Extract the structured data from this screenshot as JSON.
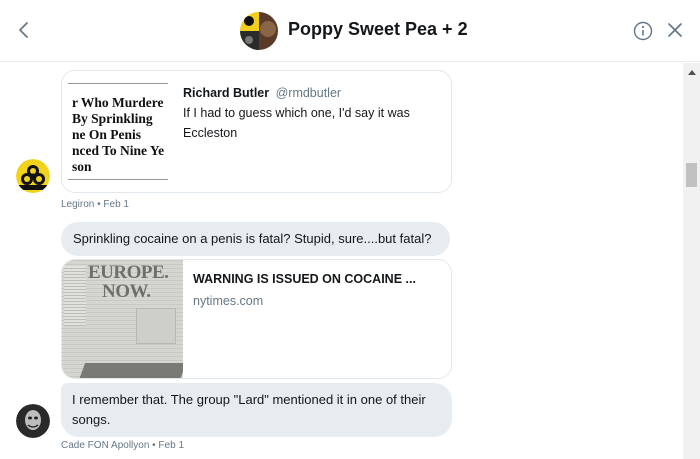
{
  "header": {
    "title": "Poppy Sweet Pea + 2"
  },
  "quoted_tweet": {
    "headline_lines": [
      "r Who Murdere",
      "By Sprinkling",
      "ne On Penis",
      "nced To Nine Ye",
      "son"
    ],
    "author_name": "Richard Butler",
    "author_handle": "@rmdbutler",
    "text": "If I had to guess which one, I'd say it was Eccleston"
  },
  "messages": [
    {
      "meta": "Legiron • Feb 1",
      "avatar_label": "Biohazard"
    },
    {
      "text": "Sprinkling cocaine on a penis is fatal? Stupid, sure....but fatal?"
    },
    {
      "link_title": "WARNING IS ISSUED ON COCAINE ...",
      "link_domain": "nytimes.com",
      "thumb_heading_1": "EUROPE.",
      "thumb_heading_2": "NOW."
    },
    {
      "text": "I remember that. The group \"Lard\" mentioned it in one of their songs.",
      "meta": "Cade FON Apollyon • Feb 1"
    }
  ],
  "colors": {
    "bubble": "#e6ecf0",
    "meta": "#657786",
    "text": "#14171a",
    "accent": "#1da1f2"
  },
  "icons": [
    "chevron-left-icon",
    "info-icon",
    "close-icon",
    "biohazard-icon",
    "mask-icon"
  ]
}
